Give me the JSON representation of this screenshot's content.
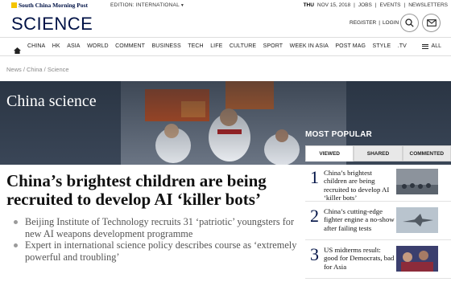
{
  "topbar": {
    "logo_text": "South China Morning Post",
    "edition_label": "EDITION: INTERNATIONAL",
    "day": "THU",
    "date": "NOV 15, 2018",
    "links": [
      "JOBS",
      "EVENTS",
      "NEWSLETTERS"
    ]
  },
  "header": {
    "section": "SCIENCE",
    "register": "REGISTER",
    "separator": "|",
    "login": "LOGIN"
  },
  "nav": {
    "items": [
      "CHINA",
      "HK",
      "ASIA",
      "WORLD",
      "COMMENT",
      "BUSINESS",
      "TECH",
      "LIFE",
      "CULTURE",
      "SPORT",
      "WEEK IN ASIA",
      "POST MAG",
      "STYLE",
      ".TV"
    ],
    "all_label": "ALL"
  },
  "breadcrumb": "News / China / Science",
  "hero": {
    "title": "China science"
  },
  "article": {
    "headline": "China’s brightest children are being recruited to develop AI ‘killer bots’",
    "bullets": [
      "Beijing Institute of Technology recruits 31 ‘patriotic’ youngsters for new AI weapons development programme",
      "Expert in international science policy describes course as ‘extremely powerful and troubling’"
    ]
  },
  "most_popular": {
    "title": "MOST POPULAR",
    "tabs": [
      "VIEWED",
      "SHARED",
      "COMMENTED"
    ],
    "active_tab": "VIEWED",
    "items": [
      {
        "num": "1",
        "text": "China’s brightest children are being recruited to develop AI ‘killer bots’"
      },
      {
        "num": "2",
        "text": "China’s cutting-edge fighter engine a no-show after failing tests"
      },
      {
        "num": "3",
        "text": "US midterms result: good for Democrats, bad for Asia"
      }
    ]
  },
  "colors": {
    "brand_navy": "#001246",
    "logo_yellow": "#f5c400"
  }
}
